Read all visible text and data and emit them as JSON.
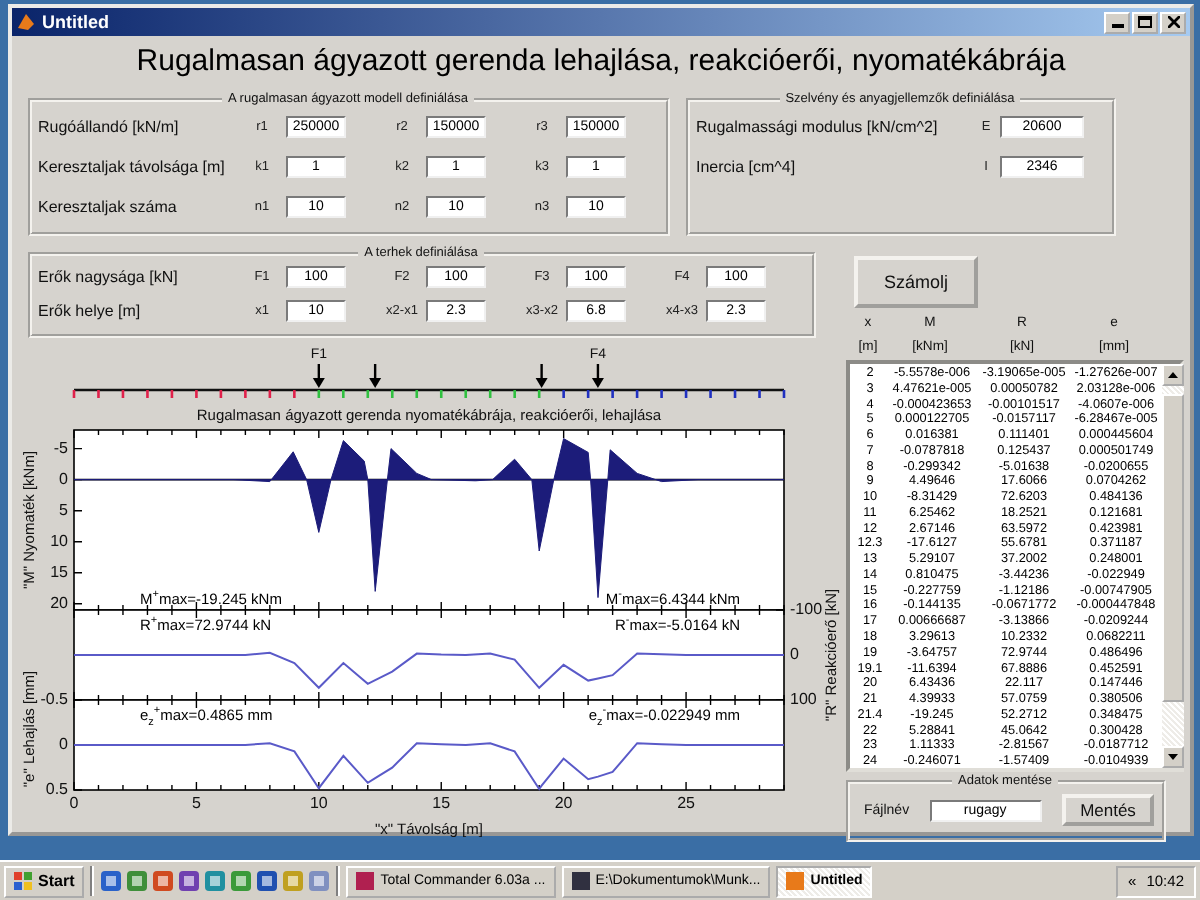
{
  "window": {
    "title": "Untitled"
  },
  "heading": "Rugalmasan ágyazott gerenda lehajlása, reakcióerői, nyomatékábrája",
  "model_group": {
    "legend": "A rugalmasan ágyazott modell definiálása",
    "rows": [
      {
        "label": "Rugóállandó [kN/m]",
        "fields": [
          {
            "name": "r1",
            "value": "250000"
          },
          {
            "name": "r2",
            "value": "150000"
          },
          {
            "name": "r3",
            "value": "150000"
          }
        ]
      },
      {
        "label": "Keresztaljak távolsága [m]",
        "fields": [
          {
            "name": "k1",
            "value": "1"
          },
          {
            "name": "k2",
            "value": "1"
          },
          {
            "name": "k3",
            "value": "1"
          }
        ]
      },
      {
        "label": "Keresztaljak száma",
        "fields": [
          {
            "name": "n1",
            "value": "10"
          },
          {
            "name": "n2",
            "value": "10"
          },
          {
            "name": "n3",
            "value": "10"
          }
        ]
      }
    ]
  },
  "section_group": {
    "legend": "Szelvény és anyagjellemzők definiálása",
    "rows": [
      {
        "label": "Rugalmassági modulus [kN/cm^2]",
        "fields": [
          {
            "name": "E",
            "value": "20600"
          }
        ]
      },
      {
        "label": "Inercia [cm^4]",
        "fields": [
          {
            "name": "I",
            "value": "2346"
          }
        ]
      }
    ]
  },
  "loads_group": {
    "legend": "A terhek definiálása",
    "rows": [
      {
        "label": "Erők nagysága [kN]",
        "fields": [
          {
            "name": "F1",
            "value": "100"
          },
          {
            "name": "F2",
            "value": "100"
          },
          {
            "name": "F3",
            "value": "100"
          },
          {
            "name": "F4",
            "value": "100"
          }
        ]
      },
      {
        "label": "Erők helye [m]",
        "fields": [
          {
            "name": "x1",
            "value": "10"
          },
          {
            "name": "x2-x1",
            "value": "2.3"
          },
          {
            "name": "x3-x2",
            "value": "6.8"
          },
          {
            "name": "x4-x3",
            "value": "2.3"
          }
        ]
      }
    ]
  },
  "calculate_button": "Számolj",
  "beam": {
    "segments": [
      {
        "color": "#e0204a"
      },
      {
        "color": "#30c040"
      },
      {
        "color": "#2030c0"
      }
    ],
    "loads": [
      {
        "kind": "labeled",
        "label": "F1"
      },
      {
        "kind": "plain"
      },
      {
        "kind": "plain"
      },
      {
        "kind": "labeled",
        "label": "F4"
      }
    ]
  },
  "charts": [
    {
      "kind": "moment",
      "chart_data": {
        "type": "area",
        "title": "Rugalmasan ágyazott gerenda nyomatékábrája, reakcióerői, lehajlása",
        "ylabel": "\"M\" Nyomaték [kNm]",
        "xlim": [
          0,
          29
        ],
        "ylim": [
          21,
          -8
        ],
        "yticks": [
          -5,
          0,
          5,
          10,
          15,
          20
        ],
        "x": [
          0,
          6.5,
          8,
          8.95,
          9.5,
          10,
          10.5,
          11,
          11.85,
          12,
          12.3,
          12.8,
          12.95,
          14,
          14.6,
          16.4,
          17.1,
          18,
          18.7,
          19,
          19.6,
          20,
          21,
          21.1,
          21.4,
          21.8,
          21.9,
          23,
          24,
          25.5,
          29
        ],
        "series": [
          {
            "color": "#1c1c7a",
            "values": [
              0,
              0,
              0.3,
              -4.5,
              0,
              8.5,
              0,
              -6.3,
              -3,
              0,
              18,
              0,
              -5,
              -1,
              0,
              0.2,
              0,
              -3.3,
              0,
              11.5,
              0,
              -6.6,
              -4.4,
              0,
              19,
              0,
              -4.8,
              -1,
              0.3,
              0,
              0
            ]
          }
        ],
        "annotations": [
          "M$^{+}$max=-19.245 kNm",
          "M$^{-}$max=6.4344 kNm"
        ]
      }
    },
    {
      "kind": "reaction",
      "chart_data": {
        "type": "line",
        "ylabel": "\"R\" Reakcióerő [kN]",
        "xlim": [
          0,
          29
        ],
        "ylim": [
          100,
          -100
        ],
        "yticks": [
          -100,
          0,
          100
        ],
        "x": [
          0,
          1,
          2,
          3,
          4,
          5,
          6,
          7,
          8,
          9,
          10,
          11,
          12,
          12.3,
          13,
          14,
          15,
          16,
          17,
          18,
          19,
          19.1,
          20,
          21,
          21.4,
          22,
          23,
          24,
          25,
          26,
          27,
          28,
          29
        ],
        "series": [
          {
            "color": "#5a5ac8",
            "values": [
              0,
              0,
              0,
              0,
              0,
              0,
              0,
              0,
              -5,
              18,
              73,
              18,
              64,
              56,
              37,
              -3,
              -1,
              0,
              -3,
              10,
              73,
              68,
              22,
              57,
              52,
              45,
              -3,
              -2,
              0,
              0,
              0,
              0,
              0
            ]
          }
        ],
        "annotations": [
          "R$^{+}$max=72.9744 kN",
          "R$^{-}$max=-5.0164 kN"
        ]
      }
    },
    {
      "kind": "deflection",
      "chart_data": {
        "type": "line",
        "ylabel": "\"e\" Lehajlás [mm]",
        "xlabel": "\"x\" Távolság [m]",
        "xlim": [
          0,
          29
        ],
        "ylim": [
          0.5,
          -0.5
        ],
        "yticks": [
          -0.5,
          0,
          0.5
        ],
        "xticks": [
          0,
          5,
          10,
          15,
          20,
          25
        ],
        "x": [
          0,
          1,
          2,
          3,
          4,
          5,
          6,
          7,
          8,
          9,
          10,
          11,
          12,
          12.3,
          13,
          14,
          15,
          16,
          17,
          18,
          19,
          19.1,
          20,
          21,
          21.4,
          22,
          23,
          24,
          25,
          26,
          27,
          28,
          29
        ],
        "series": [
          {
            "color": "#5a5ac8",
            "values": [
              0,
              0,
              0,
              0,
              0,
              0,
              0,
              0,
              -0.02,
              0.07,
              0.48,
              0.12,
              0.42,
              0.37,
              0.25,
              -0.02,
              -0.01,
              0,
              -0.02,
              0.07,
              0.49,
              0.45,
              0.15,
              0.38,
              0.35,
              0.3,
              -0.02,
              -0.01,
              0,
              0,
              0,
              0,
              0
            ]
          }
        ],
        "annotations": [
          "e$_{z}$$^{+}$max=0.4865 mm",
          "e$_{z}$$^{-}$max=-0.022949 mm"
        ]
      }
    }
  ],
  "results": {
    "columns": [
      "x",
      "M",
      "R",
      "e"
    ],
    "units": [
      "[m]",
      "[kNm]",
      "[kN]",
      "[mm]"
    ],
    "rows": [
      [
        "2",
        "-5.5578e-006",
        "-3.19065e-005",
        "-1.27626e-007"
      ],
      [
        "3",
        "4.47621e-005",
        "0.00050782",
        "2.03128e-006"
      ],
      [
        "4",
        "-0.000423653",
        "-0.00101517",
        "-4.0607e-006"
      ],
      [
        "5",
        "0.000122705",
        "-0.0157117",
        "-6.28467e-005"
      ],
      [
        "6",
        "0.016381",
        "0.111401",
        "0.000445604"
      ],
      [
        "7",
        "-0.0787818",
        "0.125437",
        "0.000501749"
      ],
      [
        "8",
        "-0.299342",
        "-5.01638",
        "-0.0200655"
      ],
      [
        "9",
        "4.49646",
        "17.6066",
        "0.0704262"
      ],
      [
        "10",
        "-8.31429",
        "72.6203",
        "0.484136"
      ],
      [
        "11",
        "6.25462",
        "18.2521",
        "0.121681"
      ],
      [
        "12",
        "2.67146",
        "63.5972",
        "0.423981"
      ],
      [
        "12.3",
        "-17.6127",
        "55.6781",
        "0.371187"
      ],
      [
        "13",
        "5.29107",
        "37.2002",
        "0.248001"
      ],
      [
        "14",
        "0.810475",
        "-3.44236",
        "-0.022949"
      ],
      [
        "15",
        "-0.227759",
        "-1.12186",
        "-0.00747905"
      ],
      [
        "16",
        "-0.144135",
        "-0.0671772",
        "-0.000447848"
      ],
      [
        "17",
        "0.00666687",
        "-3.13866",
        "-0.0209244"
      ],
      [
        "18",
        "3.29613",
        "10.2332",
        "0.0682211"
      ],
      [
        "19",
        "-3.64757",
        "72.9744",
        "0.486496"
      ],
      [
        "19.1",
        "-11.6394",
        "67.8886",
        "0.452591"
      ],
      [
        "20",
        "6.43436",
        "22.117",
        "0.147446"
      ],
      [
        "21",
        "4.39933",
        "57.0759",
        "0.380506"
      ],
      [
        "21.4",
        "-19.245",
        "52.2712",
        "0.348475"
      ],
      [
        "22",
        "5.28841",
        "45.0642",
        "0.300428"
      ],
      [
        "23",
        "1.11333",
        "-2.81567",
        "-0.0187712"
      ],
      [
        "24",
        "-0.246071",
        "-1.57409",
        "-0.0104939"
      ]
    ]
  },
  "save_group": {
    "legend": "Adatok mentése",
    "label": "Fájlnév",
    "value": "rugagy",
    "button": "Mentés"
  },
  "taskbar": {
    "start": "Start",
    "tasks": [
      {
        "label": "Total Commander 6.03a ...",
        "selected": false
      },
      {
        "label": "E:\\Dokumentumok\\Munk...",
        "selected": false
      },
      {
        "label": "Untitled",
        "selected": true
      }
    ],
    "tray_toggle": "«",
    "clock": "10:42"
  }
}
